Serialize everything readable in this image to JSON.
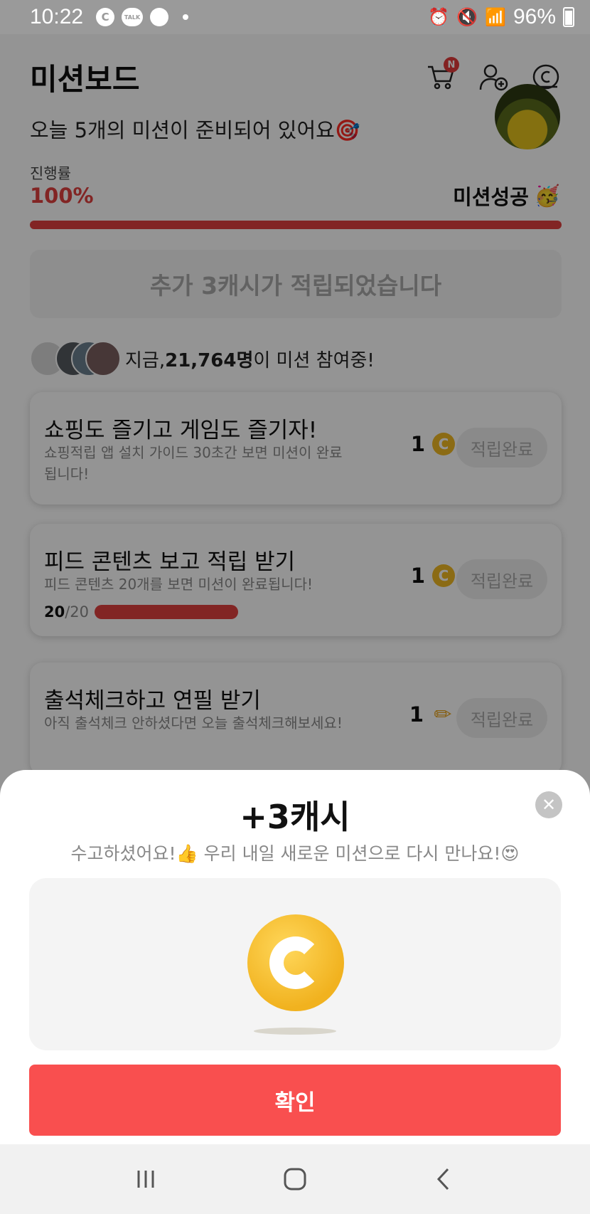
{
  "status_bar": {
    "time": "10:22",
    "battery": "96%",
    "icons": [
      "c-app-icon",
      "kakaotalk-icon",
      "chat-bubble-icon",
      "dot-icon",
      "alarm-icon",
      "mute-icon",
      "wifi-icon",
      "signal-icon",
      "battery-icon"
    ],
    "talk_label": "TALK",
    "c_label": "C"
  },
  "header": {
    "title": "미션보드",
    "cart_badge": "N"
  },
  "board": {
    "subtitle": "오늘 5개의 미션이 준비되어 있어요🎯",
    "progress_label": "진행률",
    "progress_value": "100%",
    "progress_fraction": 1.0,
    "success_label": "미션성공",
    "success_emoji": "🥳",
    "notice": "추가 3캐시가 적립되었습니다",
    "participants_prefix": "지금, ",
    "participants_count": "21,764명",
    "participants_suffix": "이 미션 참여중!"
  },
  "missions": [
    {
      "title": "쇼핑도 즐기고 게임도 즐기자!",
      "desc": "쇼핑적립 앱 설치 가이드 30초간 보면 미션이 완료됩니다!",
      "reward": "1",
      "reward_icon": "cash-coin-icon",
      "button": "적립완료"
    },
    {
      "title": "피드 콘텐츠 보고 적립 받기",
      "desc": "피드 콘텐츠 20개를 보면 미션이 완료됩니다!",
      "reward": "1",
      "reward_icon": "cash-coin-icon",
      "button": "적립완료",
      "progress_current": "20",
      "progress_total": "/20",
      "progress_fraction": 1.0
    },
    {
      "title": "출석체크하고 연필 받기",
      "desc": "아직 출석체크 안하셨다면 오늘 출석체크해보세요!",
      "reward": "1",
      "reward_icon": "pencil-icon",
      "button": "적립완료"
    }
  ],
  "sheet": {
    "title": "+3캐시",
    "message": "수고하셨어요!👍 우리 내일 새로운 미션으로 다시 만나요!😍",
    "confirm": "확인",
    "close_glyph": "✕"
  },
  "colors": {
    "accent": "#e0403f",
    "confirm": "#f94f4f",
    "coin": "#f1b21f"
  }
}
